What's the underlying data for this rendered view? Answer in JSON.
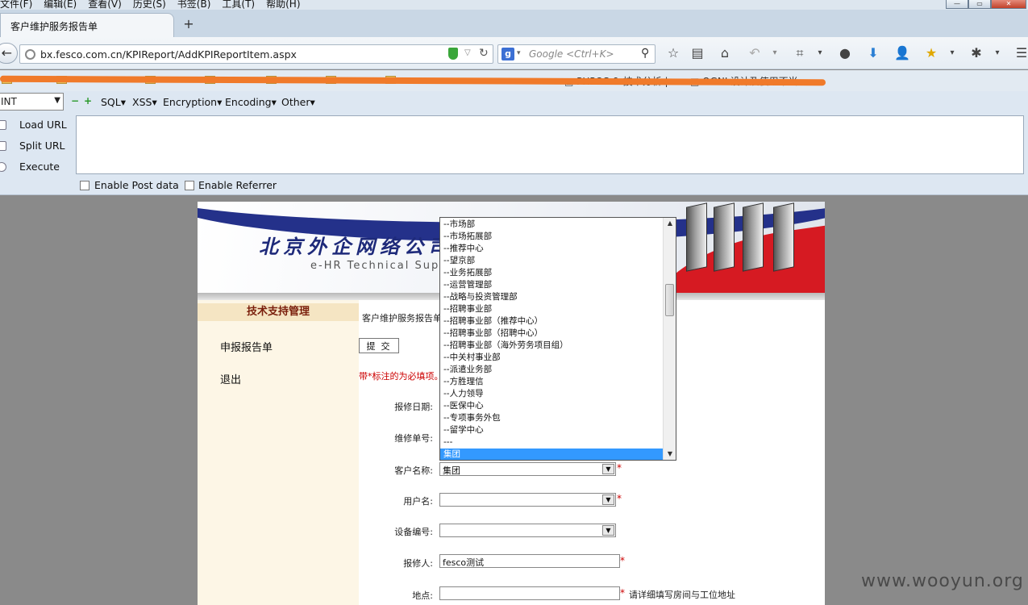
{
  "menubar": {
    "items": [
      "文件(F)",
      "编辑(E)",
      "查看(V)",
      "历史(S)",
      "书签(B)",
      "工具(T)",
      "帮助(H)"
    ]
  },
  "tab": {
    "title": "客户维护服务报告单",
    "new_tab": "+"
  },
  "navbar": {
    "url": "bx.fesco.com.cn/KPIReport/AddKPIReportItem.aspx",
    "search_placeholder": "Google <Ctrl+K>"
  },
  "bookmarks": {
    "visible_items": [
      "PHPOS & 技术分析 |",
      "OGNL设计及使用不当"
    ]
  },
  "hackbar": {
    "selected_type": "INT",
    "menus": [
      "SQL",
      "XSS",
      "Encryption",
      "Encoding",
      "Other"
    ],
    "actions": {
      "load": "Load URL",
      "split": "Split URL",
      "execute": "Execute"
    },
    "textarea_value": "",
    "enable_post": "Enable Post data",
    "enable_referrer": "Enable Referrer"
  },
  "page": {
    "banner": {
      "company_cn": "北京外企网络公司",
      "tagline_en": "e-HR Technical Sup"
    },
    "sidebar": {
      "title": "技术支持管理",
      "links": [
        "申报报告单",
        "退出"
      ]
    },
    "breadcrumb": "客户维护服务报告单",
    "submit_label": "提 交",
    "required_note": "带*标注的为必填项。",
    "form": {
      "report_date_label": "报修日期:",
      "repair_no_label": "维修单号:",
      "customer_label": "客户名称:",
      "customer_value": "集团",
      "username_label": "用户名:",
      "username_value": "",
      "device_label": "设备编号:",
      "device_value": "",
      "reporter_label": "报修人:",
      "reporter_value": "fesco测试",
      "location_label": "地点:",
      "location_value": "",
      "location_hint": "请详细填写房间与工位地址",
      "required_mark": "*"
    },
    "dropdown": {
      "options": [
        "--市场部",
        "--市场拓展部",
        "--推荐中心",
        "--望京部",
        "--业务拓展部",
        "--运营管理部",
        "--战略与投资管理部",
        "--招聘事业部",
        "--招聘事业部（推荐中心）",
        "--招聘事业部（招聘中心）",
        "--招聘事业部（海外劳务项目组）",
        "--中关村事业部",
        "--派遣业务部",
        "--方胜理信",
        "--人力领导",
        "--医保中心",
        "--专项事务外包",
        "--留学中心",
        "---",
        "集团"
      ],
      "selected_index": 19
    }
  },
  "watermark": "www.wooyun.org",
  "colors": {
    "accent_blue": "#24318a",
    "accent_red": "#d61a22",
    "selected": "#3399ff",
    "redaction": "#f07a2a"
  }
}
